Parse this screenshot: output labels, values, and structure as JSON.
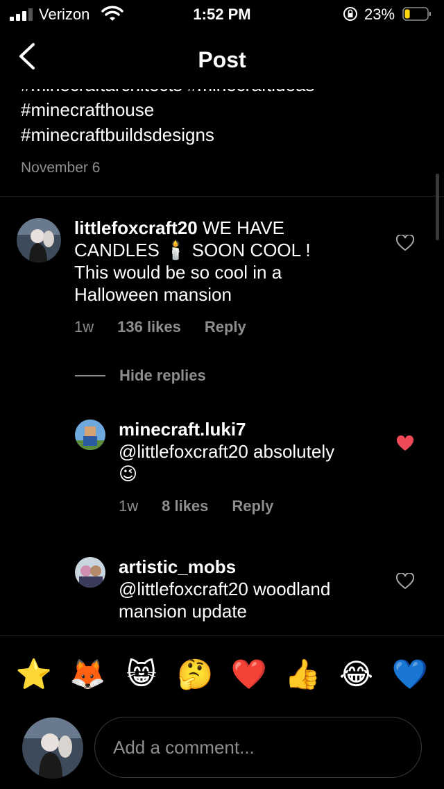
{
  "status_bar": {
    "carrier": "Verizon",
    "time": "1:52 PM",
    "battery": "23%",
    "battery_level": 0.23,
    "battery_color": "#ffd60a"
  },
  "header": {
    "title": "Post",
    "back_icon": "chevron-left-icon"
  },
  "caption": {
    "hashtags_partial": "#minecraftarchitects #minecraftideas",
    "hashtags": [
      "#minecrafthouse",
      "#minecraftbuildsdesigns"
    ],
    "date": "November 6"
  },
  "comments": [
    {
      "username": "littlefoxcraft20",
      "text_line1": " WE HAVE",
      "text_line2_a": "CANDLES ",
      "text_line2_emoji": "🕯️",
      "text_line2_b": "  SOON COOL !",
      "text_line3": "This would be so cool in a",
      "text_line4": "Halloween mansion",
      "age": "1w",
      "likes": "136 likes",
      "reply_label": "Reply",
      "liked": false
    }
  ],
  "hide_replies_label": "Hide replies",
  "replies": [
    {
      "username": "minecraft.luki7",
      "text_line1": "@littlefoxcraft20 absolutely",
      "text_line2": "😉",
      "age": "1w",
      "likes": "8 likes",
      "reply_label": "Reply",
      "liked": true
    },
    {
      "username": "artistic_mobs",
      "text_line1": "@littlefoxcraft20 woodland",
      "text_line2": "mansion update",
      "liked": false
    }
  ],
  "emoji_bar": [
    "⭐",
    "🦊",
    "😸",
    "🤔",
    "❤️",
    "👍",
    "😂",
    "💙"
  ],
  "composer": {
    "placeholder": "Add a comment..."
  },
  "colors": {
    "background": "#000000",
    "secondary_text": "#8e8e8e",
    "liked_heart": "#ed4956",
    "divider": "#262626"
  }
}
